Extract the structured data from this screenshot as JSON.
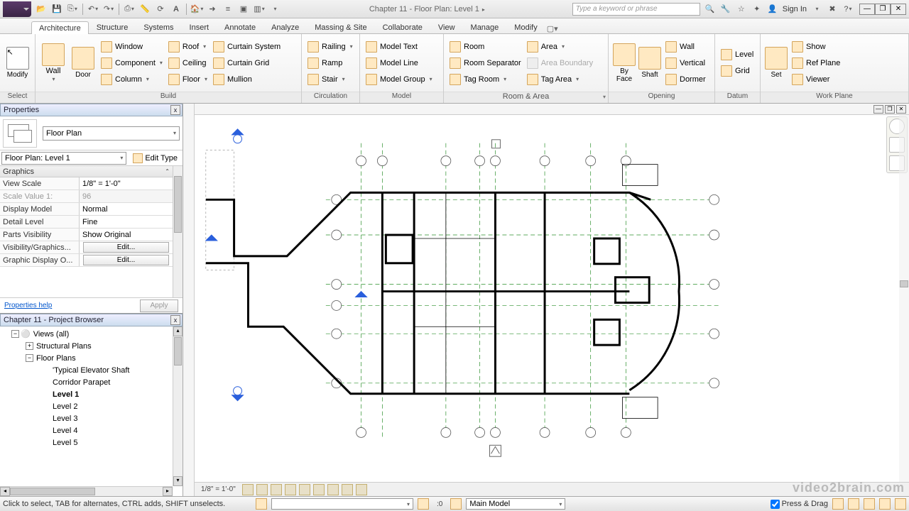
{
  "title": "Chapter 11 - Floor Plan: Level 1",
  "search_placeholder": "Type a keyword or phrase",
  "signin": "Sign In",
  "tabs": {
    "architecture": "Architecture",
    "structure": "Structure",
    "systems": "Systems",
    "insert": "Insert",
    "annotate": "Annotate",
    "analyze": "Analyze",
    "massing": "Massing & Site",
    "collaborate": "Collaborate",
    "view": "View",
    "manage": "Manage",
    "modify": "Modify"
  },
  "ribbon": {
    "select": {
      "modify": "Modify",
      "label": "Select"
    },
    "build": {
      "wall": "Wall",
      "door": "Door",
      "window": "Window",
      "component": "Component",
      "column": "Column",
      "roof": "Roof",
      "ceiling": "Ceiling",
      "floor": "Floor",
      "curtain_system": "Curtain System",
      "curtain_grid": "Curtain Grid",
      "mullion": "Mullion",
      "label": "Build"
    },
    "circ": {
      "railing": "Railing",
      "ramp": "Ramp",
      "stair": "Stair",
      "label": "Circulation"
    },
    "model": {
      "text": "Model Text",
      "line": "Model Line",
      "group": "Model Group",
      "label": "Model"
    },
    "room": {
      "room": "Room",
      "sep": "Room Separator",
      "tag_room": "Tag Room",
      "area": "Area",
      "bound": "Area Boundary",
      "tag_area": "Tag Area",
      "label": "Room & Area"
    },
    "opening": {
      "face": "By\nFace",
      "shaft": "Shaft",
      "wall": "Wall",
      "vertical": "Vertical",
      "dormer": "Dormer",
      "label": "Opening"
    },
    "datum": {
      "level": "Level",
      "grid": "Grid",
      "label": "Datum"
    },
    "workplane": {
      "set": "Set",
      "show": "Show",
      "ref": "Ref Plane",
      "viewer": "Viewer",
      "label": "Work Plane"
    }
  },
  "properties": {
    "header": "Properties",
    "type": "Floor Plan",
    "name": "Floor Plan: Level 1",
    "edit_type": "Edit Type",
    "group": "Graphics",
    "rows": [
      {
        "k": "View Scale",
        "v": "1/8\" = 1'-0\""
      },
      {
        "k": "Scale Value    1:",
        "v": "96",
        "dim": true
      },
      {
        "k": "Display Model",
        "v": "Normal"
      },
      {
        "k": "Detail Level",
        "v": "Fine"
      },
      {
        "k": "Parts Visibility",
        "v": "Show Original"
      },
      {
        "k": "Visibility/Graphics...",
        "v": "Edit...",
        "btn": true
      },
      {
        "k": "Graphic Display O...",
        "v": "Edit...",
        "btn": true
      }
    ],
    "help": "Properties help",
    "apply": "Apply"
  },
  "browser": {
    "header": "Chapter 11 - Project Browser",
    "root": "Views (all)",
    "struct": "Structural Plans",
    "floor": "Floor Plans",
    "items": [
      "'Typical Elevator Shaft",
      "Corridor Parapet",
      "Level 1",
      "Level 2",
      "Level 3",
      "Level 4",
      "Level 5"
    ]
  },
  "viewbar": {
    "scale": "1/8\" = 1'-0\""
  },
  "status": {
    "hint": "Click to select, TAB for alternates, CTRL adds, SHIFT unselects.",
    "sel": ":0",
    "model": "Main Model",
    "drag": "Press & Drag"
  },
  "watermark": "video2brain.com"
}
